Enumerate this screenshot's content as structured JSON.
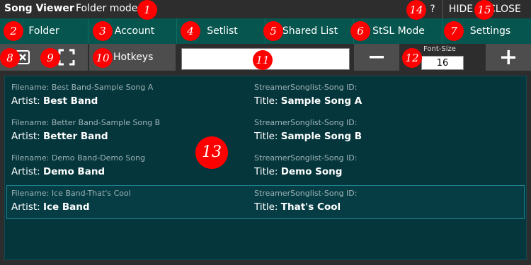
{
  "titlebar": {
    "app_title": "Song Viewer",
    "mode": "Folder mode",
    "help_label": "?",
    "hide_label": "HIDE",
    "close_label": "CLOSE"
  },
  "nav": {
    "items": [
      "Folder",
      "Account",
      "Setlist",
      "Shared List",
      "StSL Mode",
      "Settings"
    ]
  },
  "toolbar": {
    "hotkeys_label": "Hotkeys",
    "search_value": "",
    "minus_label": "−",
    "plus_label": "+",
    "font_size_label": "Font-Size",
    "font_size_value": "16"
  },
  "songs": [
    {
      "filename_label": "Filename:",
      "filename": "Best Band-Sample Song A",
      "artist_label": "Artist:",
      "artist": "Best Band",
      "id_label": "StreamerSonglist-Song ID:",
      "title_label": "Title:",
      "title": "Sample Song A"
    },
    {
      "filename_label": "Filename:",
      "filename": "Better Band-Sample Song B",
      "artist_label": "Artist:",
      "artist": "Better Band",
      "id_label": "StreamerSonglist-Song ID:",
      "title_label": "Title:",
      "title": "Sample Song B"
    },
    {
      "filename_label": "Filename:",
      "filename": "Demo Band-Demo Song",
      "artist_label": "Artist:",
      "artist": "Demo Band",
      "id_label": "StreamerSonglist-Song ID:",
      "title_label": "Title:",
      "title": "Demo Song"
    },
    {
      "filename_label": "Filename:",
      "filename": "Ice Band-That's Cool",
      "artist_label": "Artist:",
      "artist": "Ice Band",
      "id_label": "StreamerSonglist-Song ID:",
      "title_label": "Title:",
      "title": "That's Cool"
    }
  ],
  "markers": [
    "1",
    "2",
    "3",
    "4",
    "5",
    "6",
    "7",
    "8",
    "9",
    "10",
    "11",
    "12",
    "13",
    "14",
    "15"
  ],
  "colors": {
    "nav_background": "#06564f",
    "panel_background": "#05363c",
    "marker": "#ff0000",
    "button": "#4d4d4d"
  }
}
